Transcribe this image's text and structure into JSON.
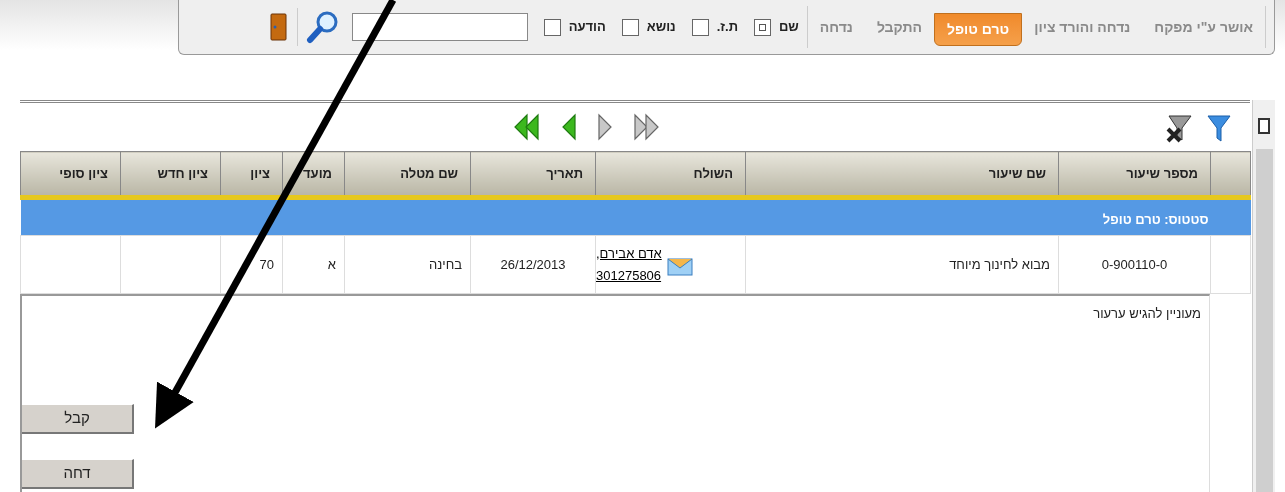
{
  "tabs": [
    {
      "label": "אושר ע\"י מפקח",
      "selected": false
    },
    {
      "label": "נדחה והורד ציון",
      "selected": false
    },
    {
      "label": "טרם טופל",
      "selected": true
    },
    {
      "label": "התקבל",
      "selected": false
    },
    {
      "label": "נדחה",
      "selected": false
    }
  ],
  "filters": [
    {
      "label": "שם",
      "checked": true
    },
    {
      "label": "ת.ז.",
      "checked": false
    },
    {
      "label": "נושא",
      "checked": false
    },
    {
      "label": "הודעה",
      "checked": false
    }
  ],
  "table": {
    "columns": [
      "מספר שיעור",
      "שם שיעור",
      "השולח",
      "תאריך",
      "שם מטלה",
      "מועד",
      "ציון",
      "ציון חדש",
      "ציון סופי"
    ],
    "group": "סטטוס: טרם טופל",
    "rows": [
      {
        "course_number": "0-900110-0",
        "course_name": "מבוא לחינוך מיוחד",
        "sender_name": "אדם אבירם,",
        "sender_id": "301275806",
        "date": "26/12/2013",
        "task": "בחינה",
        "term": "א",
        "grade": "70",
        "new_grade": "",
        "final_grade": ""
      }
    ]
  },
  "detail": {
    "message": "מעוניין להגיש ערעור",
    "buttons": [
      "קבל",
      "דחה"
    ]
  }
}
